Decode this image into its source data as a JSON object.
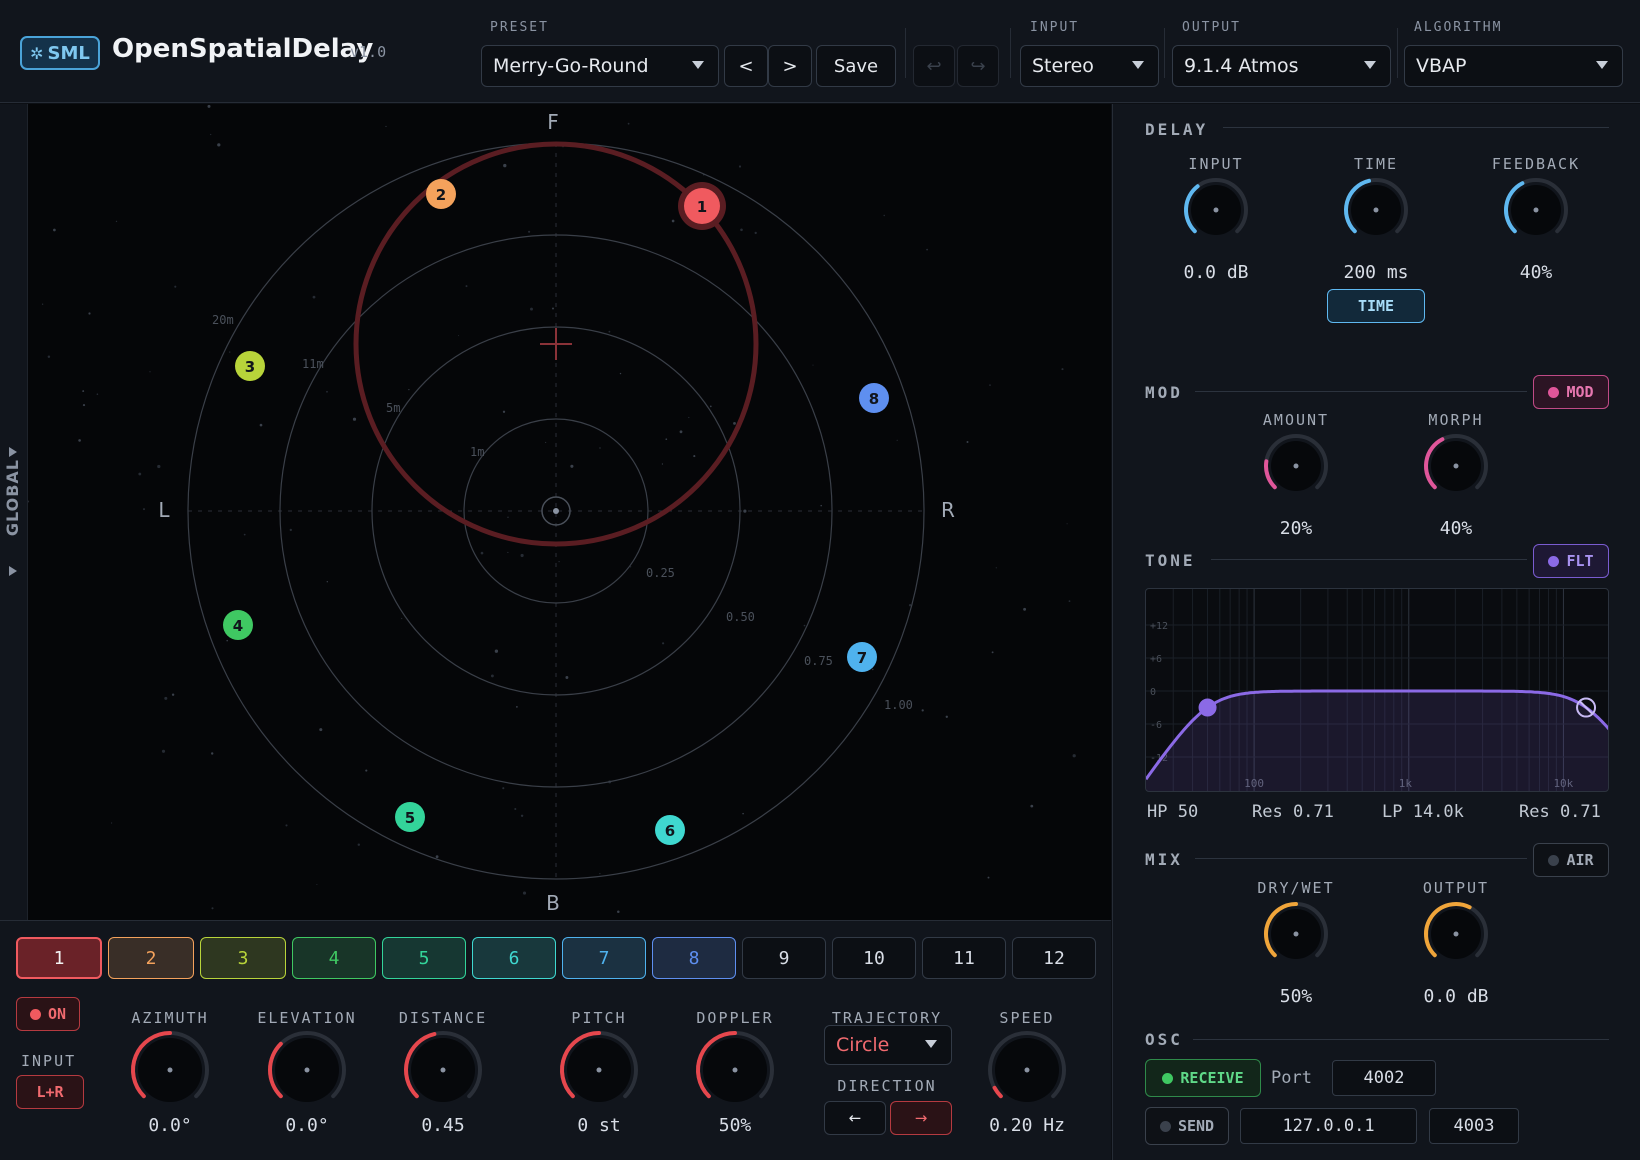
{
  "header": {
    "logo": "SML",
    "title": "OpenSpatialDelay",
    "version": "v1.0",
    "preset_label": "PRESET",
    "preset_value": "Merry-Go-Round",
    "prev_label": "<",
    "next_label": ">",
    "save_label": "Save",
    "undo_icon": "undo-icon",
    "redo_icon": "redo-icon",
    "input_label": "INPUT",
    "input_value": "Stereo",
    "output_label": "OUTPUT",
    "output_value": "9.1.4 Atmos",
    "algorithm_label": "ALGORITHM",
    "algorithm_value": "VBAP"
  },
  "sidebar": {
    "label": "GLOBAL"
  },
  "space_view": {
    "front_label": "F",
    "back_label": "B",
    "left_label": "L",
    "right_label": "R",
    "ring_distance_labels": [
      "1m",
      "5m",
      "11m",
      "20m"
    ],
    "ring_value_labels": [
      "0.25",
      "0.50",
      "0.75",
      "1.00"
    ],
    "sources": [
      {
        "id": "1",
        "color": "#f05a5f",
        "selected": true
      },
      {
        "id": "2",
        "color": "#f4a25c"
      },
      {
        "id": "3",
        "color": "#b8d43a"
      },
      {
        "id": "4",
        "color": "#3fc862"
      },
      {
        "id": "5",
        "color": "#33d49a"
      },
      {
        "id": "6",
        "color": "#3fd8d0"
      },
      {
        "id": "7",
        "color": "#4fb2ee"
      },
      {
        "id": "8",
        "color": "#5e8ff0"
      }
    ]
  },
  "source_tabs": [
    {
      "label": "1",
      "color": "#f05a5f",
      "active": true
    },
    {
      "label": "2",
      "color": "#f4a25c",
      "active": true
    },
    {
      "label": "3",
      "color": "#b8d43a",
      "active": true
    },
    {
      "label": "4",
      "color": "#3fc862",
      "active": true
    },
    {
      "label": "5",
      "color": "#33d49a",
      "active": true
    },
    {
      "label": "6",
      "color": "#3fd8d0",
      "active": true
    },
    {
      "label": "7",
      "color": "#4fb2ee",
      "active": true
    },
    {
      "label": "8",
      "color": "#5e8ff0",
      "active": true
    },
    {
      "label": "9",
      "active": false
    },
    {
      "label": "10",
      "active": false
    },
    {
      "label": "11",
      "active": false
    },
    {
      "label": "12",
      "active": false
    }
  ],
  "source_controls": {
    "on_label": "ON",
    "input_label": "INPUT",
    "input_value": "L+R",
    "azimuth_label": "AZIMUTH",
    "azimuth_value": "0.0°",
    "elevation_label": "ELEVATION",
    "elevation_value": "0.0°",
    "distance_label": "DISTANCE",
    "distance_value": "0.45",
    "pitch_label": "PITCH",
    "pitch_value": "0 st",
    "doppler_label": "DOPPLER",
    "doppler_value": "50%",
    "trajectory_label": "TRAJECTORY",
    "trajectory_value": "Circle",
    "direction_label": "DIRECTION",
    "direction_left": "←",
    "direction_right": "→",
    "speed_label": "SPEED",
    "speed_value": "0.20 Hz",
    "accent": "#e6474d"
  },
  "delay": {
    "title": "DELAY",
    "input_label": "INPUT",
    "input_value": "0.0 dB",
    "time_label": "TIME",
    "time_value": "200 ms",
    "time_button": "TIME",
    "feedback_label": "FEEDBACK",
    "feedback_value": "40%",
    "accent": "#5fb8f0"
  },
  "mod": {
    "title": "MOD",
    "toggle": "MOD",
    "amount_label": "AMOUNT",
    "amount_value": "20%",
    "morph_label": "MORPH",
    "morph_value": "40%",
    "accent": "#e0569a"
  },
  "tone": {
    "title": "TONE",
    "toggle": "FLT",
    "db_ticks": [
      "+12",
      "+6",
      "0",
      "-6",
      "-12"
    ],
    "freq_ticks": [
      "100",
      "1k",
      "10k"
    ],
    "hp_text": "HP 50",
    "hp_res": "Res 0.71",
    "lp_text": "LP 14.0k",
    "lp_res": "Res 0.71",
    "accent": "#8b6ae6"
  },
  "mix": {
    "title": "MIX",
    "toggle": "AIR",
    "drywet_label": "DRY/WET",
    "drywet_value": "50%",
    "output_label": "OUTPUT",
    "output_value": "0.0 dB",
    "accent": "#f0a53a"
  },
  "osc": {
    "title": "OSC",
    "receive_label": "RECEIVE",
    "port_label": "Port",
    "receive_port": "4002",
    "send_label": "SEND",
    "send_host": "127.0.0.1",
    "send_port": "4003"
  }
}
